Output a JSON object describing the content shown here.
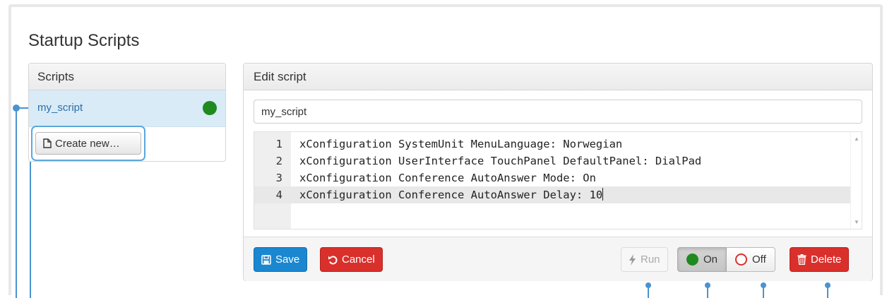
{
  "page": {
    "title": "Startup Scripts"
  },
  "scripts_panel": {
    "header": "Scripts",
    "items": [
      {
        "name": "my_script",
        "status": "on"
      }
    ],
    "create_button": "Create new…"
  },
  "edit_panel": {
    "header": "Edit script",
    "name_value": "my_script",
    "code_lines": [
      {
        "no": "1",
        "text": "xConfiguration SystemUnit MenuLanguage: Norwegian"
      },
      {
        "no": "2",
        "text": "xConfiguration UserInterface TouchPanel DefaultPanel: DialPad"
      },
      {
        "no": "3",
        "text": "xConfiguration Conference AutoAnswer Mode: On"
      },
      {
        "no": "4",
        "text": "xConfiguration Conference AutoAnswer Delay: 10"
      }
    ],
    "footer": {
      "save": "Save",
      "cancel": "Cancel",
      "run": "Run",
      "on": "On",
      "off": "Off",
      "delete": "Delete"
    }
  },
  "colors": {
    "accent": "#1a87d0",
    "danger": "#d9302c",
    "status_on": "#1f8a1f",
    "callout": "#4a93cf"
  }
}
